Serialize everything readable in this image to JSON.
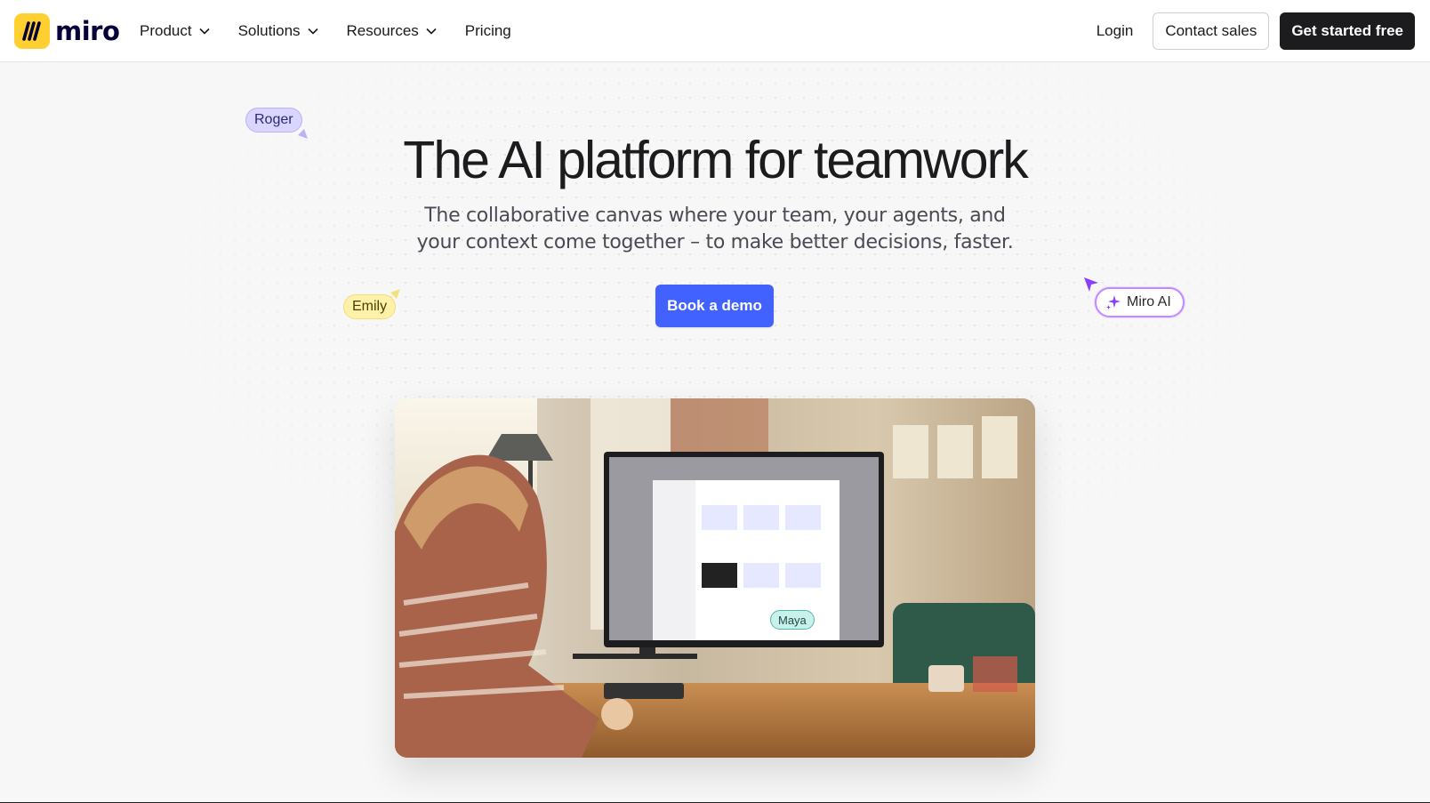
{
  "brand": {
    "name": "miro",
    "logo_color": "#ffd02f"
  },
  "nav": {
    "items": [
      {
        "label": "Product",
        "has_dropdown": true
      },
      {
        "label": "Solutions",
        "has_dropdown": true
      },
      {
        "label": "Resources",
        "has_dropdown": true
      },
      {
        "label": "Pricing",
        "has_dropdown": false
      }
    ],
    "login_label": "Login",
    "contact_sales_label": "Contact sales",
    "get_started_label": "Get started free"
  },
  "hero": {
    "title": "The AI platform for teamwork",
    "subtitle_line1": "The collaborative canvas where your team, your agents, and",
    "subtitle_line2": "your context come together – to make better decisions, faster.",
    "cta_label": "Book a demo",
    "cta_color": "#4262ff"
  },
  "cursors": {
    "roger": {
      "label": "Roger",
      "color": "#d9d5ff"
    },
    "emily": {
      "label": "Emily",
      "color": "#fff1a8"
    },
    "miro_ai": {
      "label": "Miro AI",
      "icon": "sparkle-icon",
      "color": "#8a3ffc"
    },
    "maya": {
      "label": "Maya",
      "color": "#c9f0ea"
    }
  },
  "hero_image": {
    "description_icon": "woman-at-desk-image"
  }
}
